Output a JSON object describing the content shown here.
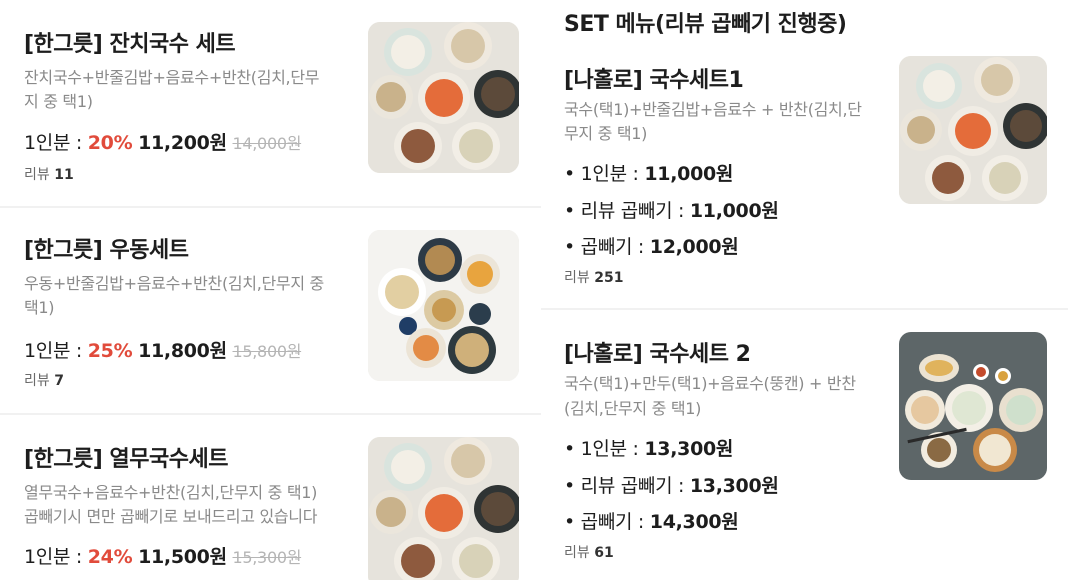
{
  "left_items": [
    {
      "title": "[한그릇] 잔치국수 세트",
      "desc1": "잔치국수+반줄김밥+음료수+반찬(김치,단무",
      "desc2": "지 중 택1)",
      "price_label": "1인분 : ",
      "discount": "20%",
      "price": "11,200원",
      "original": "14,000원",
      "review_label": "리뷰",
      "review_count": "11"
    },
    {
      "title": "[한그릇] 우동세트",
      "desc1": "우동+반줄김밥+음료수+반찬(김치,단무지 중",
      "desc2": "택1)",
      "price_label": "1인분 : ",
      "discount": "25%",
      "price": "11,800원",
      "original": "15,800원",
      "review_label": "리뷰",
      "review_count": "7"
    },
    {
      "title": "[한그릇] 열무국수세트",
      "desc1": "열무국수+음료수+반찬(김치,단무지 중 택1)",
      "desc2": "곱빼기시 면만 곱빼기로 보내드리고 있습니다",
      "price_label": "1인분 : ",
      "discount": "24%",
      "price": "11,500원",
      "original": "15,300원"
    }
  ],
  "right": {
    "section_title": "SET 메뉴(리뷰 곱빼기 진행중)",
    "items": [
      {
        "title": "[나홀로] 국수세트1",
        "desc1": "국수(택1)+반줄김밥+음료수 + 반찬(김치,단",
        "desc2": "무지 중 택1)",
        "options": [
          {
            "label": "• 1인분 : ",
            "value": "11,000원"
          },
          {
            "label": "• 리뷰 곱빼기 : ",
            "value": "11,000원"
          },
          {
            "label": "• 곱빼기 : ",
            "value": "12,000원"
          }
        ],
        "review_label": "리뷰",
        "review_count": "251"
      },
      {
        "title": "[나홀로] 국수세트 2",
        "desc1": "국수(택1)+만두(택1)+음료수(뚱캔) + 반찬",
        "desc2": "(김치,단무지 중 택1)",
        "options": [
          {
            "label": "• 1인분 : ",
            "value": "13,300원"
          },
          {
            "label": "• 리뷰 곱빼기 : ",
            "value": "13,300원"
          },
          {
            "label": "• 곱빼기 : ",
            "value": "14,300원"
          }
        ],
        "review_label": "리뷰",
        "review_count": "61"
      }
    ]
  },
  "colors": {
    "discount": "#e14b3b",
    "muted": "#8a8a8a",
    "strike": "#b5b5b5"
  },
  "images": [
    "noodle-set-platter",
    "udon-set-platter",
    "noodle-set-platter",
    "noodle-set-platter",
    "dumpling-set-platter"
  ]
}
